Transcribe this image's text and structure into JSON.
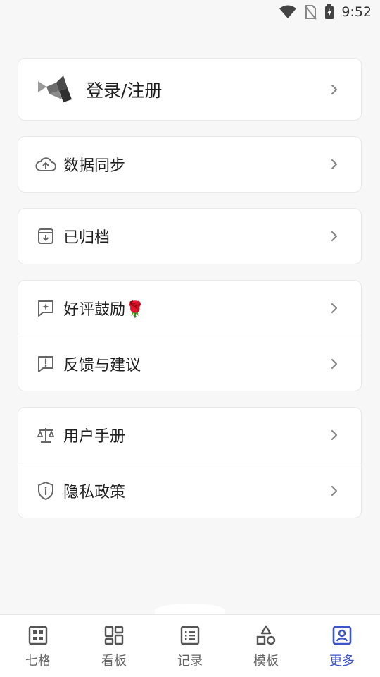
{
  "status": {
    "time": "9:52"
  },
  "account": {
    "login_label": "登录/注册"
  },
  "menu": {
    "sync_label": "数据同步",
    "archive_label": "已归档",
    "rate_label": "好评鼓励🌹",
    "feedback_label": "反馈与建议",
    "manual_label": "用户手册",
    "privacy_label": "隐私政策"
  },
  "tabs": [
    {
      "label": "七格",
      "icon": "grid-icon"
    },
    {
      "label": "看板",
      "icon": "board-icon"
    },
    {
      "label": "记录",
      "icon": "list-icon"
    },
    {
      "label": "模板",
      "icon": "shapes-icon"
    },
    {
      "label": "更多",
      "icon": "profile-icon"
    }
  ],
  "colors": {
    "accent": "#3d55c7",
    "icon": "#666666",
    "background": "#f7f7f7"
  }
}
